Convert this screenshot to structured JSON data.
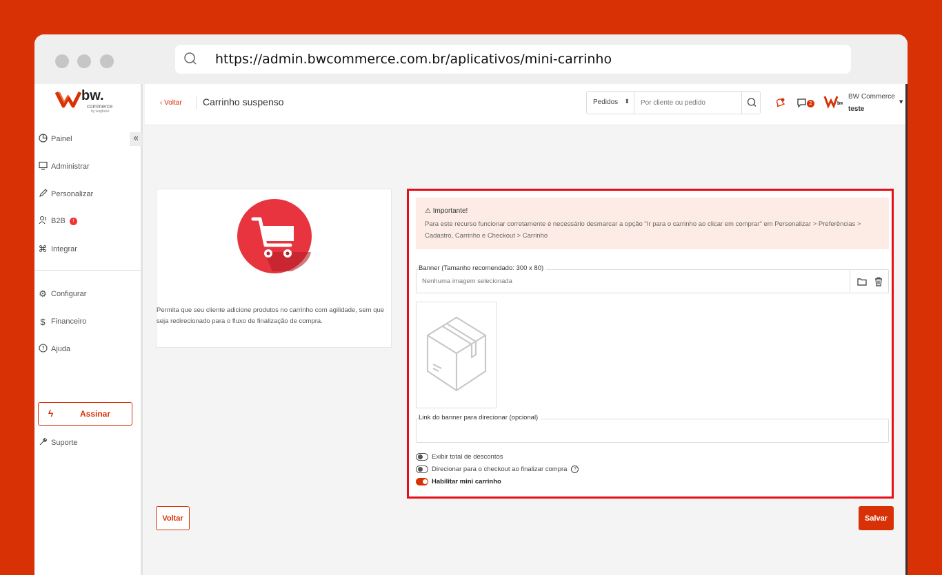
{
  "browser": {
    "url": "https://admin.bwcommerce.com.br/aplicativos/mini-carrinho"
  },
  "logo": {
    "brand": "bw.",
    "sub": "commerce",
    "tagline": "by wagbase"
  },
  "sidebar": {
    "collapse_label": "«",
    "items": [
      {
        "label": "Painel",
        "icon": "pie-chart-icon"
      },
      {
        "label": "Administrar",
        "icon": "monitor-icon"
      },
      {
        "label": "Personalizar",
        "icon": "pencil-icon"
      },
      {
        "label": "B2B",
        "icon": "users-icon"
      },
      {
        "label": "Integrar",
        "icon": "command-icon"
      },
      {
        "label": "Configurar",
        "icon": "gear-icon"
      },
      {
        "label": "Financeiro",
        "icon": "dollar-icon"
      },
      {
        "label": "Ajuda",
        "icon": "help-circle-icon"
      }
    ],
    "b2b_badge": "!",
    "assinar_label": "Assinar",
    "suporte_label": "Suporte"
  },
  "topbar": {
    "back_label": "‹ Voltar",
    "title": "Carrinho suspenso",
    "search_select": "Pedidos",
    "search_placeholder": "Por cliente ou pedido",
    "messages_count": "2",
    "user_name": "BW Commerce",
    "store_name": "teste"
  },
  "left_card": {
    "description": "Permita que seu cliente adicione produtos no carrinho com agilidade, sem que seja redirecionado para o fluxo de finalização de compra."
  },
  "alert": {
    "title": "Importante!",
    "body": "Para este recurso funcionar corretamente é necessário desmarcar a opção \"Ir para o carrinho ao clicar em comprar\" em Personalizar > Preferências > Cadastro, Carrinho e Checkout > Carrinho"
  },
  "form": {
    "banner_label": "Banner (Tamanho recomendado: 300 x 80)",
    "banner_placeholder": "Nenhuma imagem selecionada",
    "link_label": "Link do banner para direcionar (opcional)",
    "link_value": "",
    "toggles": [
      {
        "label": "Exibir total de descontos",
        "on": false
      },
      {
        "label": "Direcionar para o checkout ao finalizar compra",
        "on": false
      },
      {
        "label": "Habilitar mini carrinho",
        "on": true
      }
    ]
  },
  "actions": {
    "voltar": "Voltar",
    "salvar": "Salvar"
  },
  "colors": {
    "brand": "#d93106",
    "highlight_border": "#e80d16",
    "alert_bg": "#fdece6",
    "cart_circle": "#e8343f"
  }
}
